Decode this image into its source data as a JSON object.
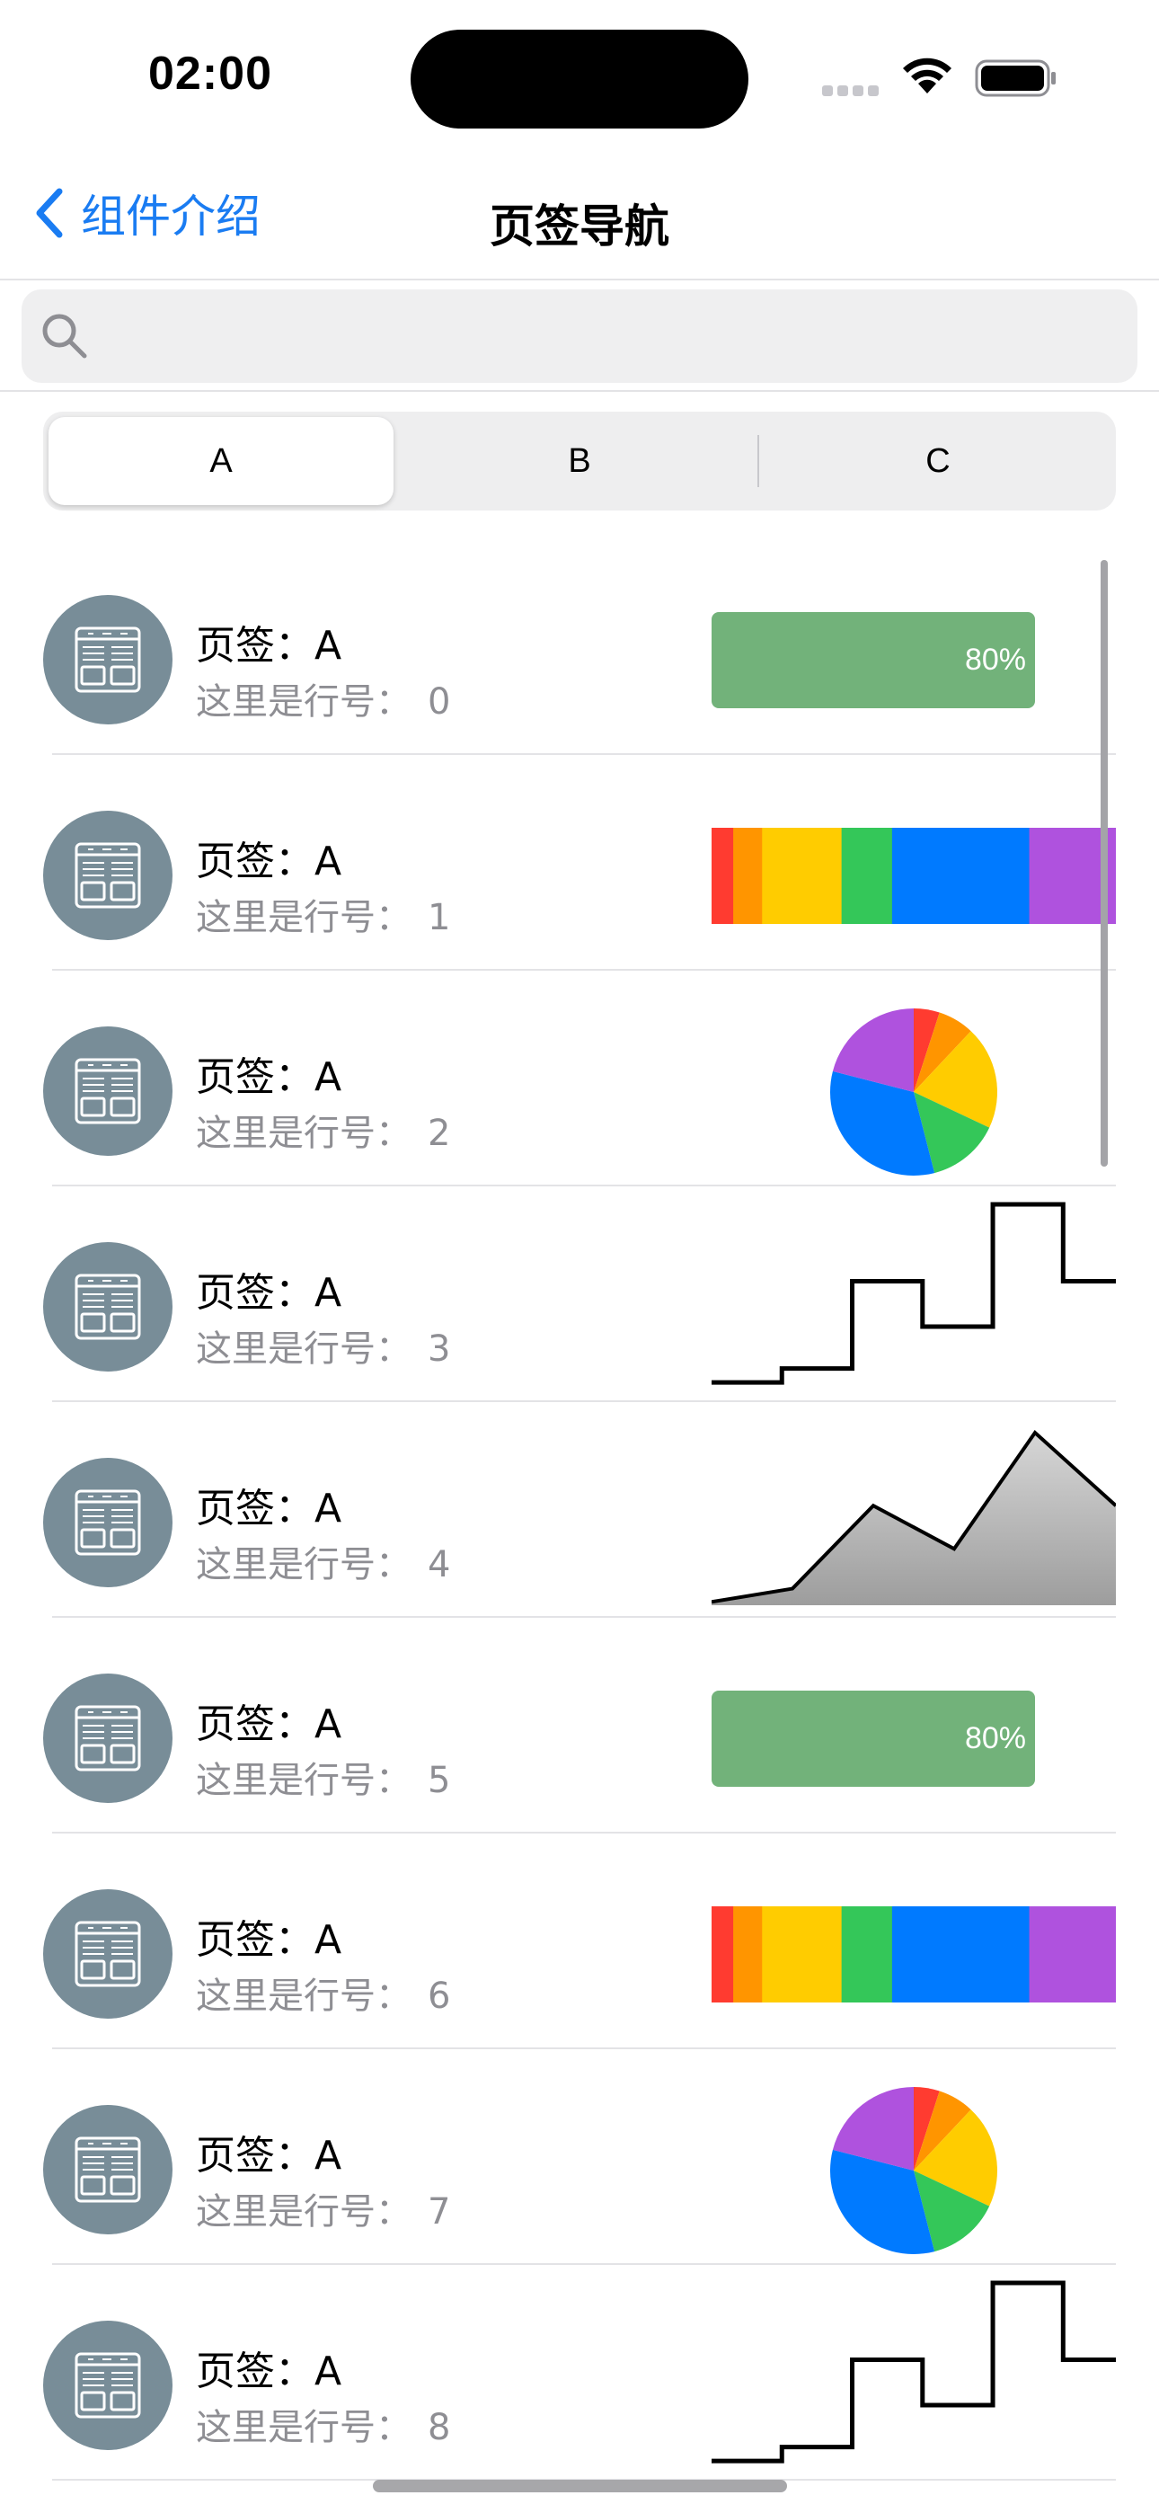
{
  "status_bar": {
    "time": "02:00",
    "wifi_icon": "wifi-icon",
    "battery_icon": "battery-icon"
  },
  "nav": {
    "back_label": "组件介绍",
    "back_icon": "chevron-left-icon",
    "title": "页签导航"
  },
  "search": {
    "placeholder": "",
    "value": "",
    "icon": "search-icon"
  },
  "tabs": [
    {
      "label": "A",
      "selected": true
    },
    {
      "label": "B",
      "selected": false
    },
    {
      "label": "C",
      "selected": false
    }
  ],
  "rows": [
    {
      "title": "页签：A",
      "subtitle": "这里是行号：",
      "index": "0",
      "viz": "progress"
    },
    {
      "title": "页签：A",
      "subtitle": "这里是行号：",
      "index": "1",
      "viz": "stacked"
    },
    {
      "title": "页签：A",
      "subtitle": "这里是行号：",
      "index": "2",
      "viz": "pie"
    },
    {
      "title": "页签：A",
      "subtitle": "这里是行号：",
      "index": "3",
      "viz": "step"
    },
    {
      "title": "页签：A",
      "subtitle": "这里是行号：",
      "index": "4",
      "viz": "area"
    },
    {
      "title": "页签：A",
      "subtitle": "这里是行号：",
      "index": "5",
      "viz": "progress"
    },
    {
      "title": "页签：A",
      "subtitle": "这里是行号：",
      "index": "6",
      "viz": "stacked"
    },
    {
      "title": "页签：A",
      "subtitle": "这里是行号：",
      "index": "7",
      "viz": "pie"
    },
    {
      "title": "页签：A",
      "subtitle": "这里是行号：",
      "index": "8",
      "viz": "step"
    }
  ],
  "progress": {
    "value": 0.8,
    "label": "80%",
    "color": "#72b27a"
  },
  "stacked": {
    "values": [
      3,
      4,
      11,
      7,
      19,
      12
    ],
    "colors": [
      "#ff3b30",
      "#ff9500",
      "#ffcc00",
      "#34c759",
      "#007aff",
      "#af52de"
    ]
  },
  "pie": {
    "values": [
      5,
      7,
      20,
      14,
      33,
      21
    ],
    "colors": [
      "#ff3b30",
      "#ff9500",
      "#ffcc00",
      "#34c759",
      "#007aff",
      "#af52de"
    ]
  },
  "step": {
    "values": [
      0.1,
      0.5,
      3,
      1.7,
      5.2,
      3
    ]
  },
  "area": {
    "values": [
      0.1,
      0.5,
      3,
      1.7,
      5.2,
      3
    ]
  },
  "icons": {
    "avatar": "table-icon"
  }
}
